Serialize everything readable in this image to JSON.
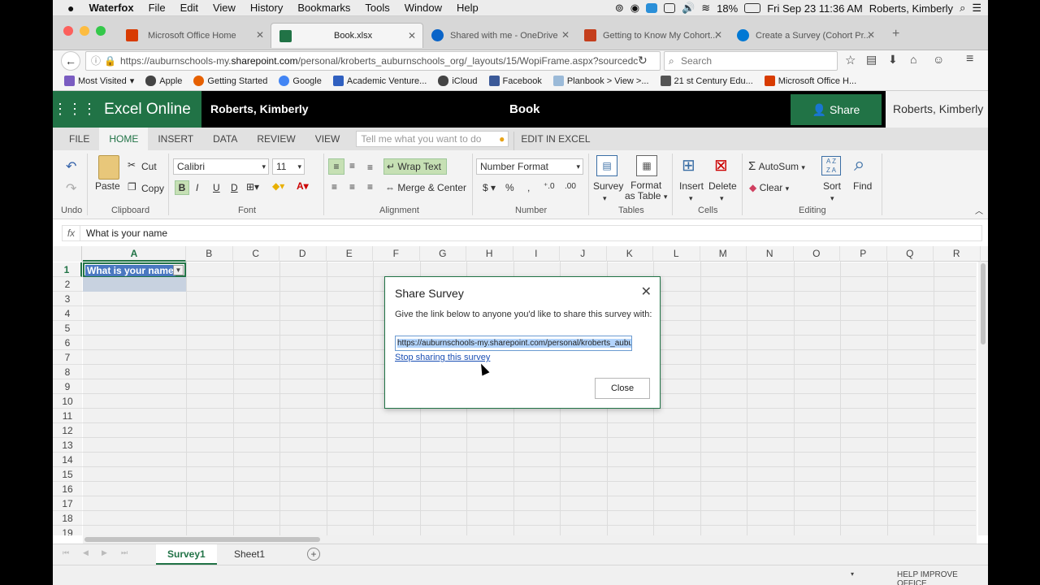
{
  "menubar": {
    "app": "Waterfox",
    "items": [
      "File",
      "Edit",
      "View",
      "History",
      "Bookmarks",
      "Tools",
      "Window",
      "Help"
    ],
    "battery": "18%",
    "clock": "Fri Sep 23  11:36 AM",
    "user": "Roberts, Kimberly"
  },
  "tabs": [
    {
      "label": "Microsoft Office Home",
      "color": "#d83b01"
    },
    {
      "label": "Book.xlsx",
      "color": "#217346"
    },
    {
      "label": "Shared with me - OneDrive",
      "color": "#0a64c8"
    },
    {
      "label": "Getting to Know My Cohort...",
      "color": "#c43e1c"
    },
    {
      "label": "Create a Survey (Cohort Pr...",
      "color": "#0078d4"
    }
  ],
  "nav": {
    "url_prefix": "https://auburnschools-my.",
    "url_domain": "sharepoint.com",
    "url_rest": "/personal/kroberts_auburnschools_org/_layouts/15/WopiFrame.aspx?sourcedc",
    "search_placeholder": "Search"
  },
  "bookmarks": [
    {
      "label": "Most Visited",
      "color": "#7a5cc1"
    },
    {
      "label": "Apple",
      "color": "#444"
    },
    {
      "label": "Getting Started",
      "color": "#e66000"
    },
    {
      "label": "Google",
      "color": "#4285f4"
    },
    {
      "label": "Academic Venture...",
      "color": "#3060c0"
    },
    {
      "label": "iCloud",
      "color": "#444"
    },
    {
      "label": "Facebook",
      "color": "#3b5998"
    },
    {
      "label": "Planbook > View >...",
      "color": "#9bbad8"
    },
    {
      "label": "21 st Century Edu...",
      "color": "#555"
    },
    {
      "label": "Microsoft Office H...",
      "color": "#d83b01"
    }
  ],
  "excel": {
    "app_name": "Excel Online",
    "user": "Roberts, Kimberly",
    "book": "Book",
    "share_label": "Share",
    "user_right": "Roberts, Kimberly"
  },
  "ribbon_tabs": [
    "FILE",
    "HOME",
    "INSERT",
    "DATA",
    "REVIEW",
    "VIEW"
  ],
  "tellme_placeholder": "Tell me what you want to do",
  "edit_in_excel": "EDIT IN EXCEL",
  "ribbon": {
    "undo_group": "Undo",
    "paste": "Paste",
    "cut": "Cut",
    "copy": "Copy",
    "clipboard_group": "Clipboard",
    "font_name": "Calibri",
    "font_size": "11",
    "font_group": "Font",
    "wrap_text": "Wrap Text",
    "merge_center": "Merge & Center",
    "alignment_group": "Alignment",
    "number_format": "Number Format",
    "number_group": "Number",
    "survey": "Survey",
    "format_table_1": "Format",
    "format_table_2": "as Table",
    "tables_group": "Tables",
    "insert": "Insert",
    "delete": "Delete",
    "cells_group": "Cells",
    "autosum": "AutoSum",
    "clear": "Clear",
    "sort": "Sort",
    "find": "Find",
    "editing_group": "Editing"
  },
  "formula": {
    "fx": "fx",
    "value": "What is your name"
  },
  "grid": {
    "columns": [
      "A",
      "B",
      "C",
      "D",
      "E",
      "F",
      "G",
      "H",
      "I",
      "J",
      "K",
      "L",
      "M",
      "N",
      "O",
      "P",
      "Q",
      "R"
    ],
    "rows": [
      "1",
      "2",
      "3",
      "4",
      "5",
      "6",
      "7",
      "8",
      "9",
      "10",
      "11",
      "12",
      "13",
      "14",
      "15",
      "16",
      "17",
      "18",
      "19"
    ],
    "a1": "What is your name"
  },
  "sheets": [
    "Survey1",
    "Sheet1"
  ],
  "status": "HELP IMPROVE OFFICE",
  "dialog": {
    "title": "Share Survey",
    "message": "Give the link below to anyone you'd like to share this survey with:",
    "url": "https://auburnschools-my.sharepoint.com/personal/kroberts_aubu",
    "stop": "Stop sharing this survey",
    "close": "Close"
  }
}
